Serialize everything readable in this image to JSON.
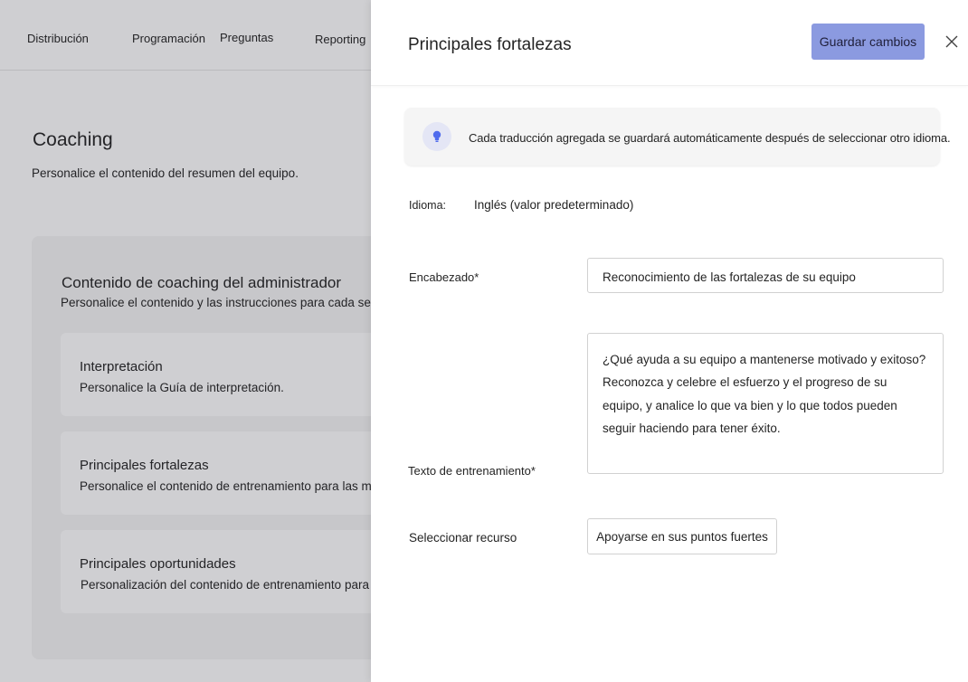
{
  "nav": {
    "items": [
      "Distribución",
      "Programación",
      "Preguntas",
      "Reporting"
    ]
  },
  "background": {
    "title": "Coaching",
    "subtitle": "Personalice el contenido del resumen del equipo.",
    "card": {
      "title": "Contenido de coaching del administrador",
      "subtitle": "Personalice el contenido y las instrucciones para cada sección.",
      "sections": [
        {
          "title": "Interpretación",
          "desc": "Personalice la Guía de interpretación."
        },
        {
          "title": "Principales fortalezas",
          "desc": "Personalice el contenido de entrenamiento para las mejores fortalezas."
        },
        {
          "title": "Principales oportunidades",
          "desc": "Personalización del contenido de entrenamiento para la mejor oportunidad"
        }
      ]
    }
  },
  "panel": {
    "title": "Principales fortalezas",
    "save_label": "Guardar cambios",
    "info_text": "Cada traducción agregada se guardará automáticamente después de seleccionar otro idioma.",
    "language_label": "Idioma:",
    "language_value": "Inglés (valor predeterminado)",
    "heading_label": "Encabezado*",
    "heading_value": "Reconocimiento de las fortalezas de su equipo",
    "coaching_label": "Texto de entrenamiento*",
    "coaching_lines": [
      "¿Qué ayuda a su equipo a mantenerse motivado y exitoso?",
      "Reconozca y celebre el esfuerzo y el progreso de su",
      "equipo, y analice lo que va bien y lo que todos pueden",
      "seguir haciendo para tener éxito."
    ],
    "resource_label": "Seleccionar recurso",
    "resource_value": "Apoyarse en sus puntos fuertes"
  },
  "colors": {
    "accent": "#8b9ae0",
    "bulb": "#4f6bed"
  },
  "icons": {
    "close": "close-icon",
    "bulb": "lightbulb-icon"
  }
}
